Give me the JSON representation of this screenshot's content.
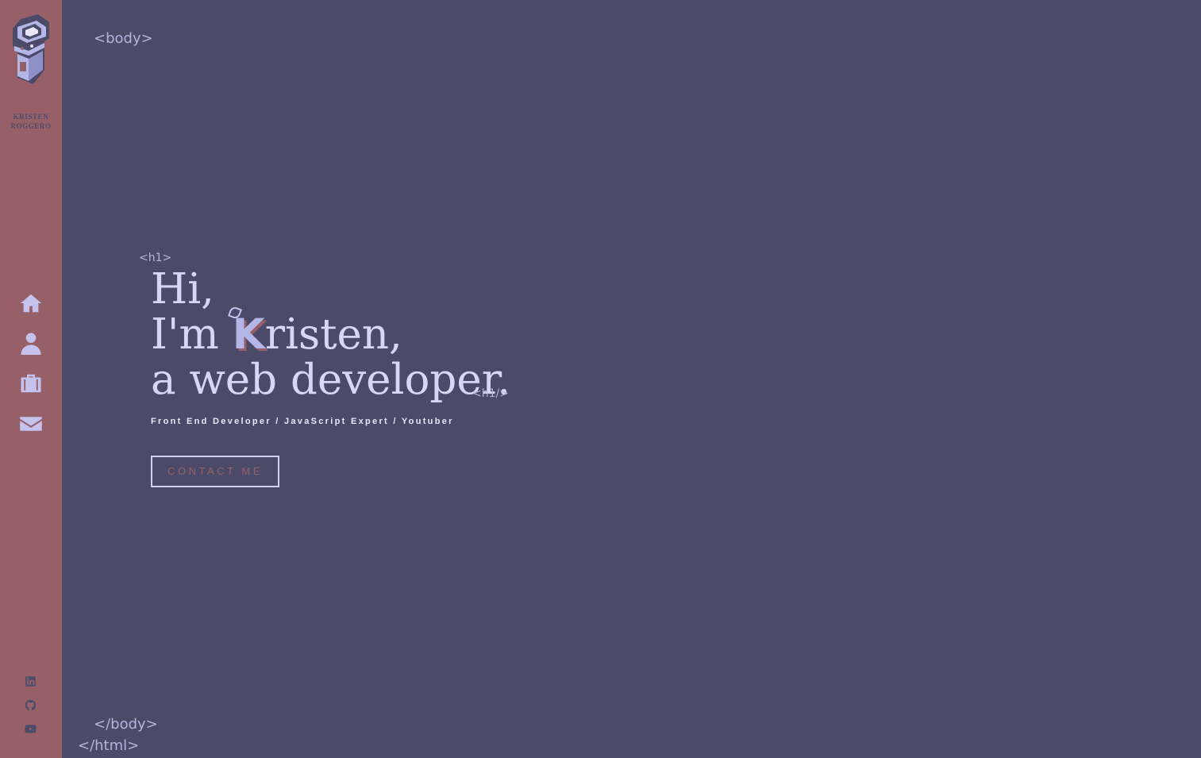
{
  "sidebar": {
    "logo_name_line1": "KRISTEN",
    "logo_name_line2": "ROGGERO",
    "nav": [
      {
        "label": "home",
        "icon": "home-icon"
      },
      {
        "label": "about",
        "icon": "user-icon"
      },
      {
        "label": "portfolio",
        "icon": "briefcase-icon"
      },
      {
        "label": "contact",
        "icon": "envelope-icon"
      }
    ],
    "social": [
      {
        "label": "linkedin",
        "icon": "linkedin-icon"
      },
      {
        "label": "github",
        "icon": "github-icon"
      },
      {
        "label": "youtube",
        "icon": "youtube-icon"
      }
    ]
  },
  "tags": {
    "body_open": "<body>",
    "body_close": "</body>",
    "html_close": "</html>",
    "h1_open": "<h1>",
    "h1_close": "<h1/>"
  },
  "hero": {
    "line1": "Hi,",
    "line2_prefix": "I'm ",
    "line2_highlight": "K",
    "line2_suffix": "risten,",
    "line3": "a web developer.",
    "subtitle": "Front End Developer / JavaScript Expert / Youtuber",
    "cta_label": "CONTACT ME"
  },
  "colors": {
    "background": "#4b4b69",
    "sidebar": "#976069",
    "text": "#d8d5f5",
    "tag": "#b5b2dd"
  }
}
